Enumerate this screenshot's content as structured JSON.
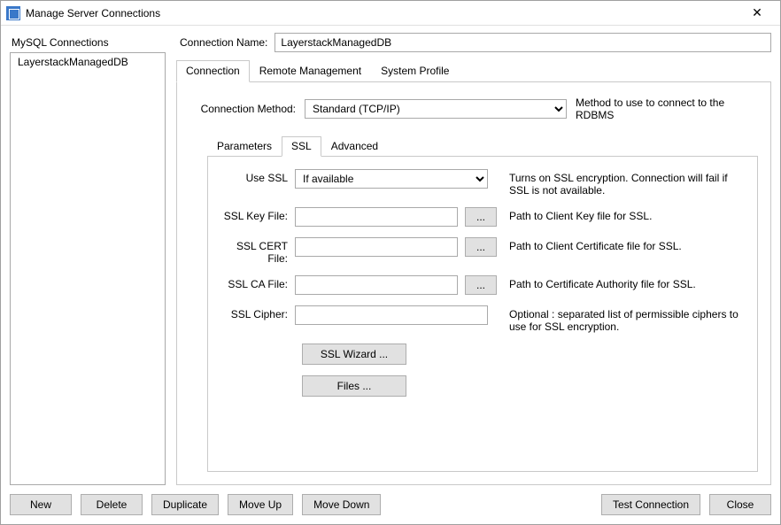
{
  "window": {
    "title": "Manage Server Connections"
  },
  "leftPanel": {
    "label": "MySQL Connections",
    "items": [
      "LayerstackManagedDB"
    ]
  },
  "connectionName": {
    "label": "Connection Name:",
    "value": "LayerstackManagedDB"
  },
  "mainTabs": {
    "connection": "Connection",
    "remote": "Remote Management",
    "system": "System Profile",
    "active": "connection"
  },
  "method": {
    "label": "Connection Method:",
    "value": "Standard (TCP/IP)",
    "hint": "Method to use to connect to the RDBMS"
  },
  "subTabs": {
    "parameters": "Parameters",
    "ssl": "SSL",
    "advanced": "Advanced",
    "active": "ssl"
  },
  "ssl": {
    "useSsl": {
      "label": "Use SSL",
      "value": "If available",
      "desc": "Turns on SSL encryption. Connection will fail if SSL is not available."
    },
    "keyFile": {
      "label": "SSL Key File:",
      "value": "",
      "desc": "Path to Client Key file for SSL."
    },
    "certFile": {
      "label": "SSL CERT File:",
      "value": "",
      "desc": "Path to Client Certificate file for SSL."
    },
    "caFile": {
      "label": "SSL CA File:",
      "value": "",
      "desc": "Path to Certificate Authority file for SSL."
    },
    "cipher": {
      "label": "SSL Cipher:",
      "value": "",
      "desc": "Optional : separated list of permissible ciphers to use for SSL encryption."
    },
    "browse": "...",
    "wizardBtn": "SSL Wizard ...",
    "filesBtn": "Files ..."
  },
  "footer": {
    "new": "New",
    "delete": "Delete",
    "duplicate": "Duplicate",
    "moveUp": "Move Up",
    "moveDown": "Move Down",
    "test": "Test Connection",
    "close": "Close"
  }
}
